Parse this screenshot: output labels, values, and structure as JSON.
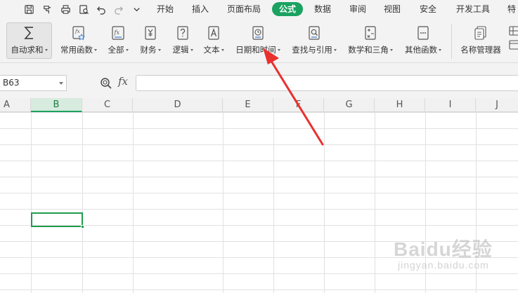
{
  "menubar": {
    "tabs": [
      {
        "label": "开始"
      },
      {
        "label": "插入"
      },
      {
        "label": "页面布局"
      },
      {
        "label": "公式",
        "active": true
      },
      {
        "label": "数据"
      },
      {
        "label": "审阅"
      },
      {
        "label": "视图"
      },
      {
        "label": "安全"
      },
      {
        "label": "开发工具"
      },
      {
        "label": "特"
      }
    ],
    "quick_access_icons": [
      "save-icon",
      "format-painter-icon",
      "print-icon",
      "print-preview-icon",
      "undo-icon",
      "redo-icon",
      "more-icon"
    ]
  },
  "ribbon": {
    "buttons": [
      {
        "label": "自动求和",
        "icon": "autosum-icon"
      },
      {
        "label": "常用函数",
        "icon": "common-functions-icon"
      },
      {
        "label": "全部",
        "icon": "all-functions-icon"
      },
      {
        "label": "财务",
        "icon": "financial-icon"
      },
      {
        "label": "逻辑",
        "icon": "logical-icon"
      },
      {
        "label": "文本",
        "icon": "text-icon"
      },
      {
        "label": "日期和时间",
        "icon": "date-time-icon"
      },
      {
        "label": "查找与引用",
        "icon": "lookup-reference-icon"
      },
      {
        "label": "数学和三角",
        "icon": "math-trig-icon"
      },
      {
        "label": "其他函数",
        "icon": "other-functions-icon"
      },
      {
        "label": "名称管理器",
        "icon": "name-manager-icon"
      }
    ]
  },
  "formula_bar": {
    "name_box": "B63",
    "fx_label": "fx",
    "formula": ""
  },
  "sheet": {
    "columns": [
      "A",
      "B",
      "C",
      "D",
      "E",
      "F",
      "G",
      "H",
      "I",
      "J"
    ],
    "active_column": "B"
  },
  "watermark": {
    "brand": "Baidu经验",
    "site": "jingyan.baidu.com"
  },
  "colors": {
    "accent": "#1aa260",
    "arrow": "#e8302f",
    "selection": "#1f9d4c"
  }
}
